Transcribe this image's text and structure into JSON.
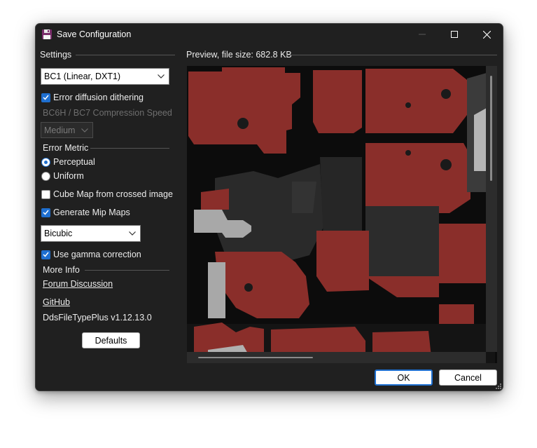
{
  "window": {
    "title": "Save Configuration",
    "controls": {
      "minimize": "minimize",
      "maximize": "maximize",
      "close": "close"
    }
  },
  "settings": {
    "header": "Settings",
    "format_value": "BC1 (Linear, DXT1)",
    "error_diffusion_label": "Error diffusion dithering",
    "error_diffusion_checked": true,
    "compression_speed_header": "BC6H / BC7 Compression Speed",
    "compression_speed_value": "Medium",
    "error_metric_header": "Error Metric",
    "metric_perceptual_label": "Perceptual",
    "metric_uniform_label": "Uniform",
    "metric_selected": "Perceptual",
    "cube_map_label": "Cube Map from crossed image",
    "cube_map_checked": false,
    "mipmaps_label": "Generate Mip Maps",
    "mipmaps_checked": true,
    "resample_value": "Bicubic",
    "gamma_label": "Use gamma correction",
    "gamma_checked": true,
    "more_info_header": "More Info",
    "forum_link": "Forum Discussion",
    "github_link": "GitHub",
    "version": "DdsFileTypePlus v1.12.13.0",
    "defaults_button": "Defaults"
  },
  "preview": {
    "header": "Preview, file size: 682.8 KB"
  },
  "buttons": {
    "ok": "OK",
    "cancel": "Cancel"
  },
  "colors": {
    "accent": "#1e6fd0",
    "window_bg": "#202020",
    "texture_red": "#8a2e2a",
    "texture_dark": "#2a2a2a",
    "texture_grey": "#a8a8a8"
  },
  "icons": {
    "app": "floppy-disk-icon",
    "dropdown": "chevron-down-icon",
    "check": "checkmark-icon"
  }
}
